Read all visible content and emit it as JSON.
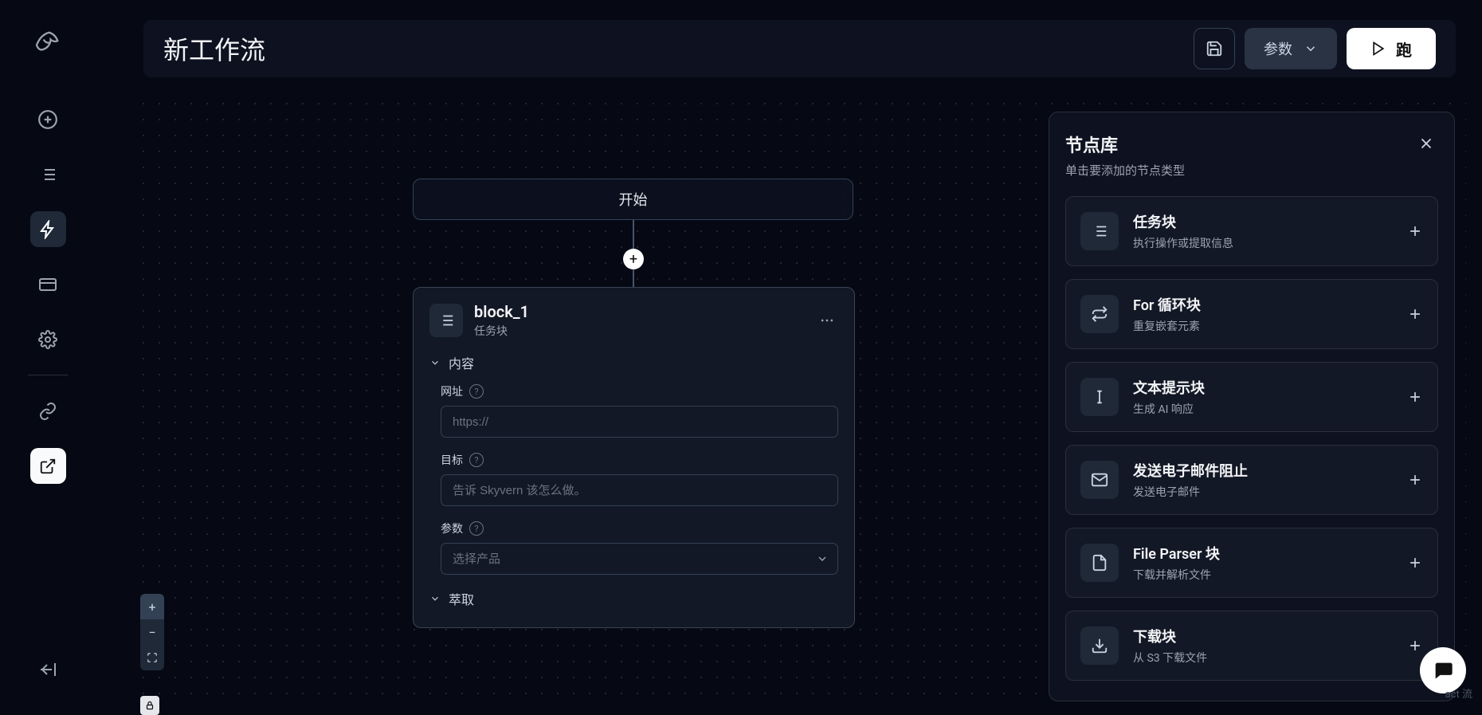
{
  "header": {
    "title": "新工作流",
    "params_label": "参数",
    "run_label": "跑"
  },
  "canvas": {
    "start_label": "开始"
  },
  "block": {
    "name": "block_1",
    "type": "任务块",
    "section_content": "内容",
    "section_extract": "萃取",
    "url_label": "网址",
    "url_placeholder": "https://",
    "goal_label": "目标",
    "goal_placeholder": "告诉 Skyvern 该怎么做。",
    "params_label": "参数",
    "params_placeholder": "选择产品"
  },
  "panel": {
    "title": "节点库",
    "subtitle": "单击要添加的节点类型",
    "items": [
      {
        "name": "任务块",
        "desc": "执行操作或提取信息",
        "icon": "list"
      },
      {
        "name": "For 循环块",
        "desc": "重复嵌套元素",
        "icon": "loop"
      },
      {
        "name": "文本提示块",
        "desc": "生成 AI 响应",
        "icon": "cursor"
      },
      {
        "name": "发送电子邮件阻止",
        "desc": "发送电子邮件",
        "icon": "mail"
      },
      {
        "name": "File Parser 块",
        "desc": "下载并解析文件",
        "icon": "file"
      },
      {
        "name": "下载块",
        "desc": "从 S3 下载文件",
        "icon": "download"
      }
    ]
  },
  "attrib": "act 流"
}
